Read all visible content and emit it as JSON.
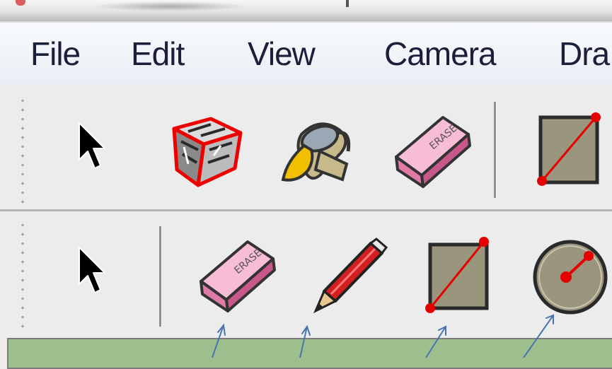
{
  "menu": {
    "file": "File",
    "edit": "Edit",
    "view": "View",
    "camera": "Camera",
    "draw": "Dra"
  },
  "toolbar_top": {
    "tools": [
      "select-arrow-icon",
      "component-box-icon",
      "paint-bucket-icon",
      "eraser-icon",
      "rectangle-icon"
    ]
  },
  "toolbar_bottom": {
    "tools": [
      "select-arrow-icon",
      "eraser-icon",
      "pencil-icon",
      "rectangle-icon",
      "circle-icon"
    ]
  },
  "colors": {
    "menu_text": "#1a1f3a",
    "eraser_pink": "#f2a2c4",
    "pencil_red": "#d41f1f",
    "shape_fill": "#9a957d",
    "edge_red": "#e60000",
    "status_field": "#9dbf8d",
    "annotation_arrow": "#4a74b0"
  }
}
